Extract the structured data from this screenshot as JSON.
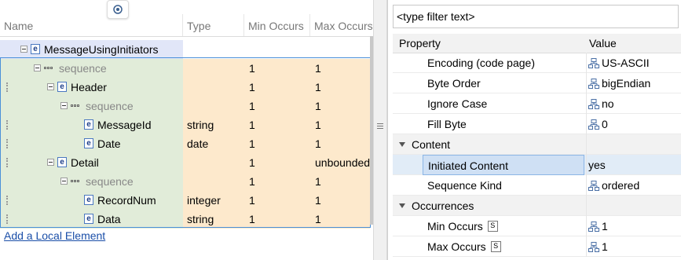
{
  "left_panel": {
    "columns": {
      "name": "Name",
      "type": "Type",
      "min": "Min Occurs",
      "max": "Max Occurs"
    },
    "rows": [
      {
        "label": "MessageUsingInitiators",
        "kind": "element",
        "type": "",
        "min": "",
        "max": ""
      },
      {
        "label": "sequence",
        "kind": "sequence",
        "type": "",
        "min": "1",
        "max": "1"
      },
      {
        "label": "Header",
        "kind": "element",
        "type": "",
        "min": "1",
        "max": "1"
      },
      {
        "label": "sequence",
        "kind": "sequence",
        "type": "",
        "min": "1",
        "max": "1"
      },
      {
        "label": "MessageId",
        "kind": "element",
        "type": "string",
        "min": "1",
        "max": "1"
      },
      {
        "label": "Date",
        "kind": "element",
        "type": "date",
        "min": "1",
        "max": "1"
      },
      {
        "label": "Detail",
        "kind": "element",
        "type": "",
        "min": "1",
        "max": "unbounded"
      },
      {
        "label": "sequence",
        "kind": "sequence",
        "type": "",
        "min": "1",
        "max": "1"
      },
      {
        "label": "RecordNum",
        "kind": "element",
        "type": "integer",
        "min": "1",
        "max": "1"
      },
      {
        "label": "Data",
        "kind": "element",
        "type": "string",
        "min": "1",
        "max": "1"
      }
    ],
    "add_link": "Add a Local Element",
    "element_icon_letter": "e"
  },
  "right_panel": {
    "filter_text": "<type filter text>",
    "headers": {
      "property": "Property",
      "value": "Value"
    },
    "rows": [
      {
        "name": "Encoding (code page)",
        "value": "US-ASCII",
        "icon": "inherited-icon"
      },
      {
        "name": "Byte Order",
        "value": "bigEndian",
        "icon": "inherited-icon"
      },
      {
        "name": "Ignore Case",
        "value": "no",
        "icon": "inherited-icon"
      },
      {
        "name": "Fill Byte",
        "value": "0",
        "icon": "inherited-icon"
      },
      {
        "name": "Content",
        "category": true
      },
      {
        "name": "Initiated Content",
        "value": "yes",
        "highlight": true
      },
      {
        "name": "Sequence Kind",
        "value": "ordered",
        "icon": "inherited-icon"
      },
      {
        "name": "Occurrences",
        "category": true
      },
      {
        "name": "Min Occurs",
        "value": "1",
        "icon": "inherited-icon",
        "badge": "S"
      },
      {
        "name": "Max Occurs",
        "value": "1",
        "icon": "inherited-icon",
        "badge": "S"
      }
    ]
  }
}
